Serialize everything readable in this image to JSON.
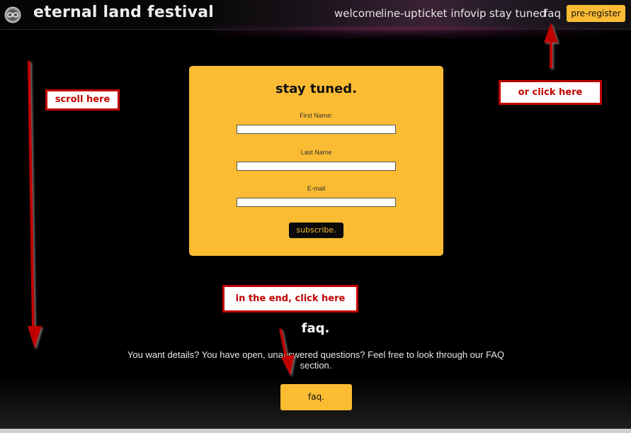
{
  "header": {
    "site_title": "eternal land festival",
    "logo_icon": "infinity-globe-logo-icon",
    "nav": [
      {
        "label": "welcome"
      },
      {
        "label": "line-up"
      },
      {
        "label": "ticket info"
      },
      {
        "label": "vip"
      },
      {
        "label": "stay tuned"
      },
      {
        "label": "faq"
      }
    ],
    "preregister_label": "pre-register"
  },
  "signup": {
    "title": "stay tuned.",
    "fields": [
      {
        "label": "First Name:",
        "value": ""
      },
      {
        "label": "Last Name",
        "value": ""
      },
      {
        "label": "E-mail",
        "value": ""
      }
    ],
    "subscribe_label": "subscribe."
  },
  "faq": {
    "title": "faq.",
    "text": "You want details? You have open, unanswered questions? Feel free to look through our FAQ section.",
    "button_label": "faq."
  },
  "annotations": {
    "scroll": "scroll here",
    "click_nav": "or click here",
    "click_end": "in the end, click here"
  },
  "colors": {
    "accent": "#fbbc33",
    "background": "#000000",
    "annotation": "#c00000"
  }
}
